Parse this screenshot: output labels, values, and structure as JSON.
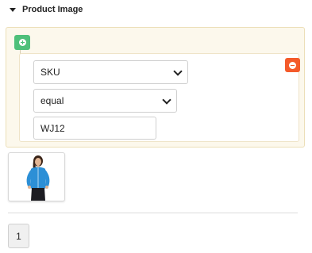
{
  "section": {
    "title": "Product Image"
  },
  "condition": {
    "field": "SKU",
    "operator": "equal",
    "value": "WJ12"
  },
  "colors": {
    "add": "#4ec07a",
    "remove": "#f45a2a",
    "panel_bg": "#fcf8ec"
  },
  "icons": {
    "add": "plus-circle-icon",
    "remove": "minus-circle-icon",
    "collapse": "caret-down-icon"
  },
  "pagination": {
    "pages": [
      "1"
    ]
  }
}
